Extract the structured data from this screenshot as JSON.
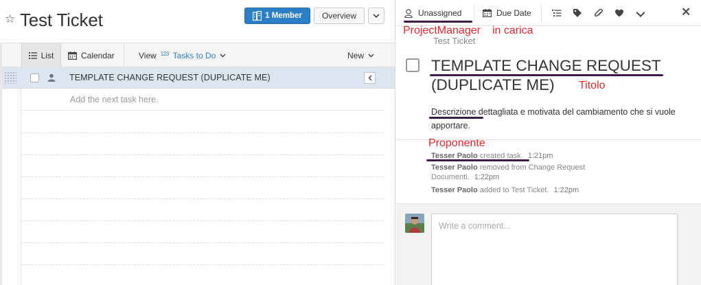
{
  "project": {
    "title": "Test Ticket",
    "member_button": "1 Member",
    "overview_button": "Overview"
  },
  "toolbar": {
    "list": "List",
    "calendar": "Calendar",
    "view": "View",
    "view_icon_text": "123",
    "tasks_to_do": "Tasks to Do",
    "new": "New"
  },
  "tasks": [
    {
      "name": "TEMPLATE CHANGE REQUEST (DUPLICATE ME)"
    }
  ],
  "add_task_placeholder": "Add the next task here.",
  "detail": {
    "assignee": "Unassigned",
    "due_date": "Due Date",
    "project_name": "Test Ticket",
    "title": "TEMPLATE CHANGE REQUEST (DUPLICATE ME)",
    "description": "Descrizione dettagliata e motivata del cambiamento che si vuole apportare.",
    "activity": [
      {
        "user": "Tesser Paolo",
        "action": "created task.",
        "time": "1:21pm"
      },
      {
        "user": "Tesser Paolo",
        "action": "removed from Change Request Documenti.",
        "time": "1:22pm"
      },
      {
        "user": "Tesser Paolo",
        "action": "added to Test Ticket.",
        "time": "1:22pm"
      }
    ],
    "comment_placeholder": "Write a comment..."
  },
  "annotations": {
    "project_manager": "ProjectManager",
    "in_charge": "in carica",
    "title_label": "Titolo",
    "proponent": "Proponente"
  },
  "colors": {
    "accent_blue": "#2b7fc7",
    "annotation_red": "#e8262b",
    "annotation_underline": "#3b1d47",
    "selected_row": "#dde6ee"
  },
  "icons": {
    "star": "star-icon",
    "member": "building-icon",
    "list": "list-icon",
    "calendar": "calendar-icon",
    "assignee": "person-icon",
    "subtasks": "subtasks-icon",
    "tag": "tag-icon",
    "attach": "paperclip-icon",
    "like": "heart-icon",
    "close": "close-icon"
  }
}
